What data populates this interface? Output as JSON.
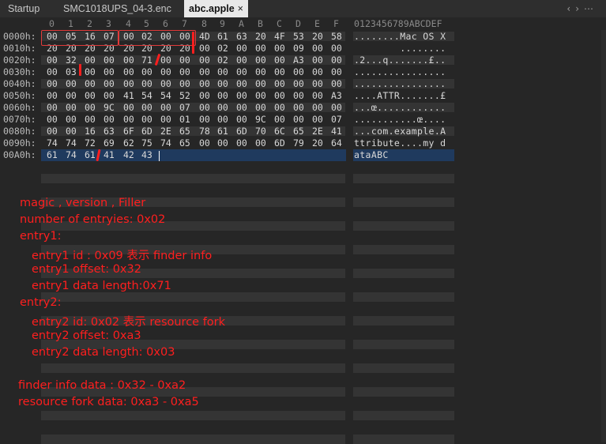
{
  "tabs": [
    {
      "label": "Startup",
      "active": false
    },
    {
      "label": "SMC1018UPS_04-3.enc",
      "active": false
    },
    {
      "label": "abc.apple",
      "active": true
    }
  ],
  "tab_close_glyph": "×",
  "nav_icons": [
    "back-icon",
    "forward-icon",
    "more-icon"
  ],
  "nav_glyphs": "‹›⋯",
  "hex_editor": {
    "column_headers": [
      "0",
      "1",
      "2",
      "3",
      "4",
      "5",
      "6",
      "7",
      "8",
      "9",
      "A",
      "B",
      "C",
      "D",
      "E",
      "F"
    ],
    "ascii_header": "0123456789ABCDEF",
    "rows": [
      {
        "offset": "0000h:",
        "bytes": [
          "00",
          "05",
          "16",
          "07",
          "00",
          "02",
          "00",
          "00",
          "4D",
          "61",
          "63",
          "20",
          "4F",
          "53",
          "20",
          "58"
        ],
        "ascii": "........Mac OS X"
      },
      {
        "offset": "0010h:",
        "bytes": [
          "20",
          "20",
          "20",
          "20",
          "20",
          "20",
          "20",
          "20",
          "00",
          "02",
          "00",
          "00",
          "00",
          "09",
          "00",
          "00"
        ],
        "ascii": "        ........"
      },
      {
        "offset": "0020h:",
        "bytes": [
          "00",
          "32",
          "00",
          "00",
          "00",
          "71",
          "00",
          "00",
          "00",
          "02",
          "00",
          "00",
          "00",
          "A3",
          "00",
          "00"
        ],
        "ascii": ".2...q.......£.."
      },
      {
        "offset": "0030h:",
        "bytes": [
          "00",
          "03",
          "00",
          "00",
          "00",
          "00",
          "00",
          "00",
          "00",
          "00",
          "00",
          "00",
          "00",
          "00",
          "00",
          "00"
        ],
        "ascii": "................"
      },
      {
        "offset": "0040h:",
        "bytes": [
          "00",
          "00",
          "00",
          "00",
          "00",
          "00",
          "00",
          "00",
          "00",
          "00",
          "00",
          "00",
          "00",
          "00",
          "00",
          "00"
        ],
        "ascii": "................"
      },
      {
        "offset": "0050h:",
        "bytes": [
          "00",
          "00",
          "00",
          "00",
          "41",
          "54",
          "54",
          "52",
          "00",
          "00",
          "00",
          "00",
          "00",
          "00",
          "00",
          "A3"
        ],
        "ascii": "....ATTR.......£"
      },
      {
        "offset": "0060h:",
        "bytes": [
          "00",
          "00",
          "00",
          "9C",
          "00",
          "00",
          "00",
          "07",
          "00",
          "00",
          "00",
          "00",
          "00",
          "00",
          "00",
          "00"
        ],
        "ascii": "...œ............"
      },
      {
        "offset": "0070h:",
        "bytes": [
          "00",
          "00",
          "00",
          "00",
          "00",
          "00",
          "00",
          "01",
          "00",
          "00",
          "00",
          "9C",
          "00",
          "00",
          "00",
          "07"
        ],
        "ascii": "...........œ...."
      },
      {
        "offset": "0080h:",
        "bytes": [
          "00",
          "00",
          "16",
          "63",
          "6F",
          "6D",
          "2E",
          "65",
          "78",
          "61",
          "6D",
          "70",
          "6C",
          "65",
          "2E",
          "41"
        ],
        "ascii": "...com.example.A"
      },
      {
        "offset": "0090h:",
        "bytes": [
          "74",
          "74",
          "72",
          "69",
          "62",
          "75",
          "74",
          "65",
          "00",
          "00",
          "00",
          "00",
          "6D",
          "79",
          "20",
          "64"
        ],
        "ascii": "ttribute....my d"
      },
      {
        "offset": "00A0h:",
        "bytes": [
          "61",
          "74",
          "61",
          "41",
          "42",
          "43"
        ],
        "ascii": "ataABC"
      }
    ]
  },
  "annotation_colors": {
    "note": "#ff1f1f",
    "box": "#e23a3a",
    "selection": "#1f3a5e"
  },
  "annotations": [
    "magic , version , Filler",
    "number of entryies: 0x02",
    "entry1:",
    "entry1 id : 0x09 表示 finder info",
    "entry1 offset: 0x32",
    "entry1 data length:0x71",
    "entry2:",
    "entry2 id: 0x02 表示 resource fork",
    "entry2 offset: 0xa3",
    "entry2 data length: 0x03",
    "finder info data : 0x32 - 0xa2",
    "resource fork data: 0xa3 - 0xa5"
  ]
}
